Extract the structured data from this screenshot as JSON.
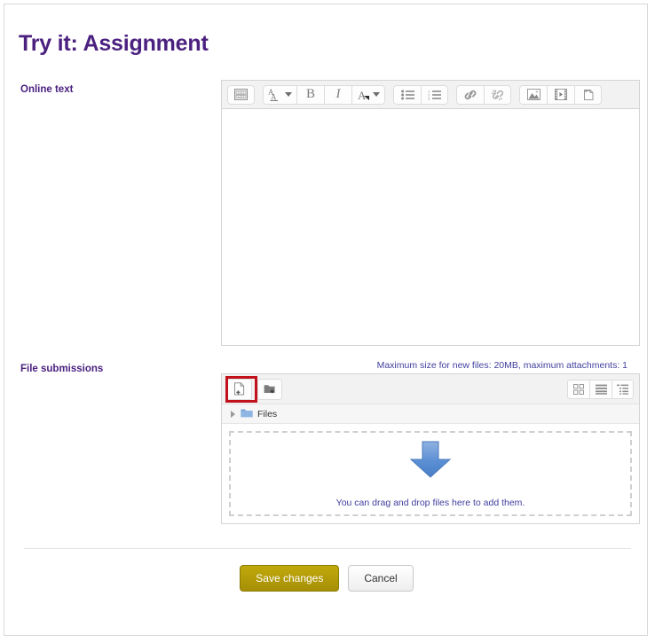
{
  "page": {
    "title": "Try it: Assignment"
  },
  "fields": {
    "online_text_label": "Online text",
    "file_submissions_label": "File submissions"
  },
  "editor": {
    "content": "",
    "toolbar_groups": [
      {
        "buttons": [
          {
            "name": "expand-toolbar-icon",
            "label": "Show more buttons"
          }
        ]
      },
      {
        "buttons": [
          {
            "name": "font-style-icon",
            "label": "Paragraph styles"
          },
          {
            "name": "bold-icon",
            "label": "Bold",
            "glyph": "B"
          },
          {
            "name": "italic-icon",
            "label": "Italic",
            "glyph": "I"
          },
          {
            "name": "text-color-icon",
            "label": "Text colour"
          }
        ]
      },
      {
        "buttons": [
          {
            "name": "bullet-list-icon",
            "label": "Unordered list"
          },
          {
            "name": "numbered-list-icon",
            "label": "Ordered list"
          }
        ]
      },
      {
        "buttons": [
          {
            "name": "link-icon",
            "label": "Link"
          },
          {
            "name": "unlink-icon",
            "label": "Unlink"
          }
        ]
      },
      {
        "buttons": [
          {
            "name": "image-icon",
            "label": "Image"
          },
          {
            "name": "media-icon",
            "label": "Media"
          },
          {
            "name": "manage-files-icon",
            "label": "Manage files"
          }
        ]
      }
    ]
  },
  "filemanager": {
    "max_size_note": "Maximum size for new files: 20MB, maximum attachments: 1",
    "toolbar": {
      "add_file_label": "Add...",
      "create_folder_label": "Create folder",
      "view_icons_label": "Display folder with file icons",
      "view_list_label": "Display folder with file details",
      "view_tree_label": "Display folder as file tree"
    },
    "path": {
      "root_label": "Files"
    },
    "dropzone": {
      "text": "You can drag and drop files here to add them."
    },
    "highlight_target": "add-file-button"
  },
  "footer": {
    "save_label": "Save changes",
    "cancel_label": "Cancel"
  },
  "colors": {
    "heading": "#4b217f",
    "link": "#3f3f9e",
    "save_button": "#a68f06",
    "highlight": "#c1121c",
    "arrow": "#5b8fd4"
  }
}
